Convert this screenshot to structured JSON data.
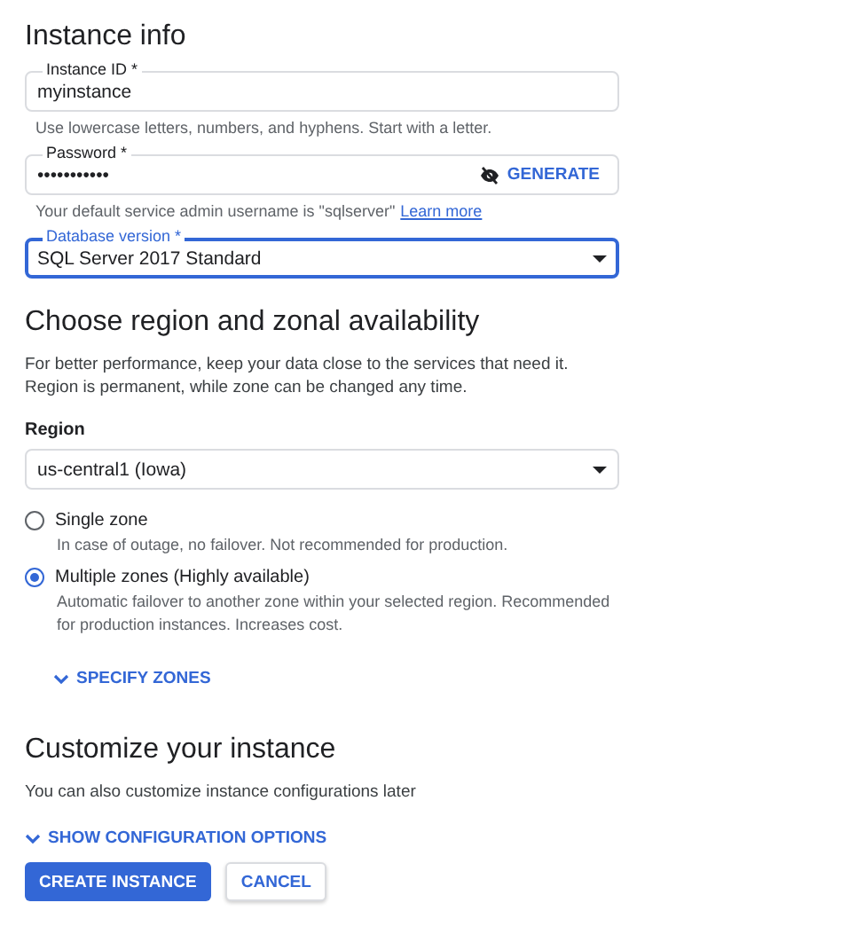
{
  "instance_info": {
    "title": "Instance info",
    "fields": [
      {
        "kind": "text",
        "label": "Instance ID *",
        "value": "myinstance",
        "focused": false,
        "helper": "Use lowercase letters, numbers, and hyphens. Start with a letter."
      },
      {
        "kind": "password",
        "label": "Password *",
        "value": "•••••••••••",
        "focused": false,
        "action": "GENERATE",
        "helper": "Your default service admin username is \"sqlserver\"",
        "helper_link": "Learn more"
      },
      {
        "kind": "select",
        "label": "Database version *",
        "value": "SQL Server 2017 Standard",
        "focused": true
      }
    ]
  },
  "region": {
    "title": "Choose region and zonal availability",
    "description": "For better performance, keep your data close to the services that need it. Region is permanent, while zone can be changed any time.",
    "label": "Region",
    "value": "us-central1 (Iowa)",
    "options": [
      {
        "label": "Single zone",
        "description": "In case of outage, no failover. Not recommended for production.",
        "selected": false
      },
      {
        "label": "Multiple zones (Highly available)",
        "description": "Automatic failover to another zone within your selected region. Recommended for production instances. Increases cost.",
        "selected": true
      }
    ],
    "expander": {
      "label": "SPECIFY ZONES",
      "expanded": false
    }
  },
  "customize": {
    "title": "Customize your instance",
    "description": "You can also customize instance configurations later",
    "expander": {
      "label": "SHOW CONFIGURATION OPTIONS",
      "expanded": false
    }
  },
  "buttons": [
    {
      "label": "CREATE INSTANCE",
      "kind": "primary"
    },
    {
      "label": "CANCEL",
      "kind": "secondary"
    }
  ]
}
